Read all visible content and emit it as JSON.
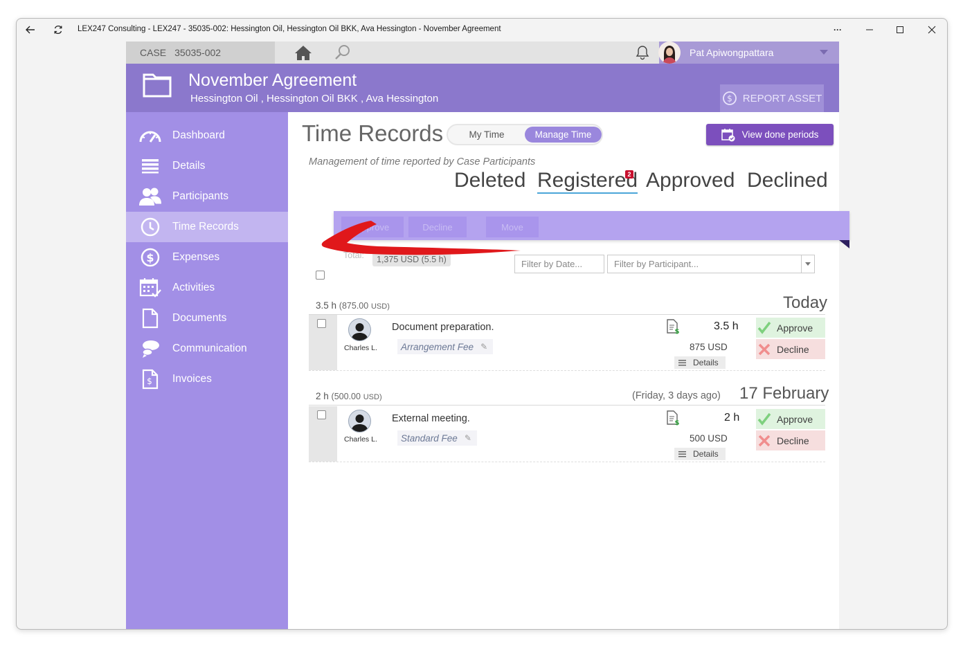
{
  "window": {
    "title": "LEX247 Consulting - LEX247 - 35035-002: Hessington Oil, Hessington Oil BKK, Ava Hessington - November Agreement",
    "more_label": "···"
  },
  "topbar": {
    "case_label": "CASE",
    "case_number": "35035-002",
    "user_name": "Pat Apiwongpattara"
  },
  "header": {
    "title": "November Agreement",
    "subtitle": "Hessington Oil ,  Hessington Oil BKK ,  Ava Hessington",
    "report_asset_label": "REPORT ASSET"
  },
  "sidebar": {
    "items": [
      {
        "label": "Dashboard",
        "icon": "gauge-icon"
      },
      {
        "label": "Details",
        "icon": "list-icon"
      },
      {
        "label": "Participants",
        "icon": "people-icon"
      },
      {
        "label": "Time Records",
        "icon": "clock-icon"
      },
      {
        "label": "Expenses",
        "icon": "dollar-icon"
      },
      {
        "label": "Activities",
        "icon": "calendar-icon"
      },
      {
        "label": "Documents",
        "icon": "document-icon"
      },
      {
        "label": "Communication",
        "icon": "chat-icon"
      },
      {
        "label": "Invoices",
        "icon": "invoice-icon"
      }
    ],
    "active_index": 3
  },
  "main": {
    "title": "Time Records",
    "toggle": {
      "option_a": "My Time",
      "option_b": "Manage Time",
      "selected": "Manage Time"
    },
    "view_done_label": "View done periods",
    "subtitle": "Management of time reported by Case Participants",
    "tabs": [
      {
        "label": "Deleted"
      },
      {
        "label": "Registered",
        "badge": "2"
      },
      {
        "label": "Approved"
      },
      {
        "label": "Declined"
      }
    ],
    "active_tab": "Registered",
    "actions": {
      "approve": "Approve",
      "decline": "Decline",
      "move": "Move"
    },
    "total_label": "Total:",
    "total_value": "1,375 USD (5.5 h)",
    "filter_date_placeholder": "Filter by Date...",
    "filter_participant_placeholder": "Filter by Participant..."
  },
  "groups": [
    {
      "hours": "3.5 h",
      "amount": "(875.00",
      "currency": "USD)",
      "relative": "",
      "date": "Today",
      "record": {
        "participant": "Charles L.",
        "description": "Document preparation.",
        "fee": "Arrangement Fee",
        "hours": "3.5 h",
        "usd": "875 USD",
        "details_label": "Details",
        "approve_label": "Approve",
        "decline_label": "Decline"
      }
    },
    {
      "hours": "2 h",
      "amount": "(500.00",
      "currency": "USD)",
      "relative": "(Friday, 3 days ago)",
      "date": "17 February",
      "record": {
        "participant": "Charles L.",
        "description": "External meeting.",
        "fee": "Standard Fee",
        "hours": "2 h",
        "usd": "500 USD",
        "details_label": "Details",
        "approve_label": "Approve",
        "decline_label": "Decline"
      }
    }
  ],
  "colors": {
    "header": "#8b78cc",
    "sidebar": "#a28fe6",
    "sidebar_active": "#c2b5f0",
    "action_button": "#7c4fbd",
    "approve_bg": "#dff3df",
    "decline_bg": "#f6dede",
    "annotation_arrow": "#e0181b"
  }
}
